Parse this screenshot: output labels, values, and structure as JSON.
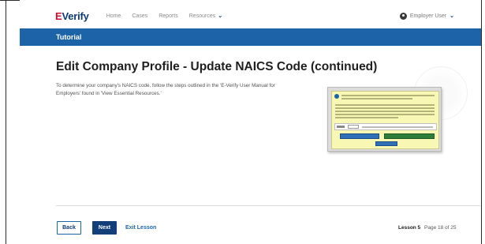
{
  "header": {
    "logo_e": "E",
    "logo_verify": "Verify",
    "nav": [
      "Home",
      "Cases",
      "Reports",
      "Resources"
    ],
    "user_label": "Employer User"
  },
  "banner": {
    "title": "Tutorial"
  },
  "main": {
    "title": "Edit Company Profile - Update NAICS Code (continued)",
    "body": "To determine your company's NAICS code, follow the steps outlined in the 'E-Verify User Manual for Employers' found in 'View Essential Resources.'"
  },
  "footer": {
    "back_label": "Back",
    "next_label": "Next",
    "exit_label": "Exit Lesson",
    "lesson": "Lesson 5",
    "page": "Page 18 of 25"
  },
  "colors": {
    "banner": "#1c63a8",
    "next_button": "#123f7a",
    "logo_red": "#c8102e",
    "logo_blue": "#0b3a75"
  },
  "icons": {
    "user": "user-circle-icon",
    "dropdown": "chevron-down-icon",
    "info": "info-icon"
  }
}
